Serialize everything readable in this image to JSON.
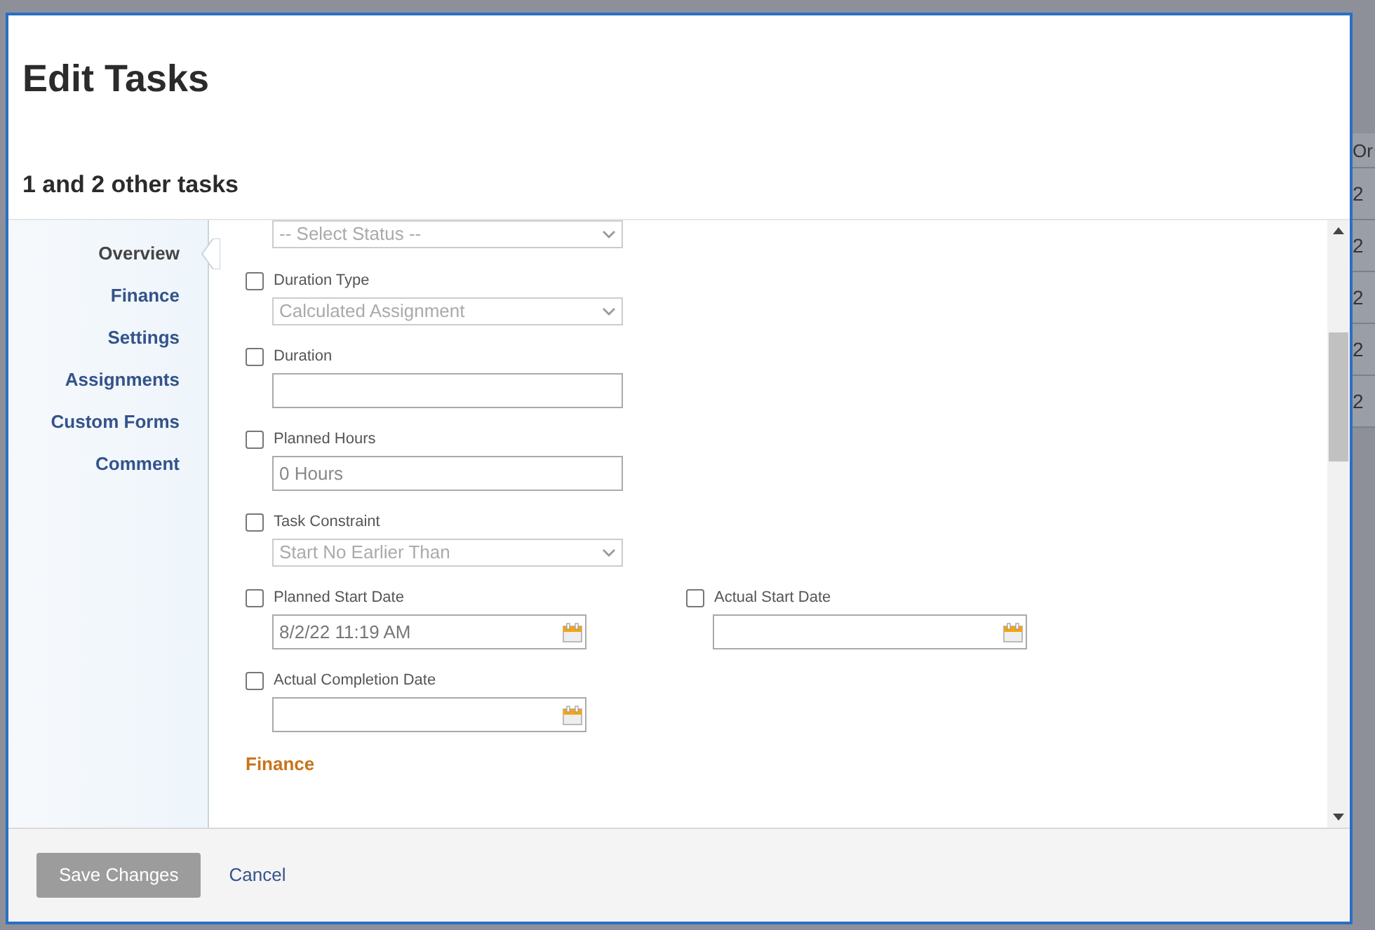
{
  "background_table": {
    "column_header": "Or",
    "cells": [
      "2",
      "2",
      "2",
      "2",
      "2"
    ]
  },
  "dialog": {
    "title": "Edit Tasks",
    "subtitle": "1 and 2 other tasks"
  },
  "sidebar": {
    "items": [
      {
        "label": "Overview",
        "selected": true
      },
      {
        "label": "Finance",
        "selected": false
      },
      {
        "label": "Settings",
        "selected": false
      },
      {
        "label": "Assignments",
        "selected": false
      },
      {
        "label": "Custom Forms",
        "selected": false
      },
      {
        "label": "Comment",
        "selected": false
      }
    ]
  },
  "form": {
    "rows": [
      [
        {
          "kind": "select",
          "value": "-- Select Status --"
        }
      ],
      [
        {
          "kind": "select",
          "label": "Duration Type",
          "checked": false,
          "value": "Calculated Assignment"
        }
      ],
      [
        {
          "kind": "input",
          "label": "Duration",
          "checked": false
        }
      ],
      [
        {
          "kind": "input",
          "label": "Planned Hours",
          "checked": false,
          "value": "0 Hours"
        }
      ],
      [
        {
          "kind": "select",
          "label": "Task Constraint",
          "checked": false,
          "value": "Start No Earlier Than"
        }
      ],
      [
        {
          "kind": "date",
          "label": "Planned Start Date",
          "checked": false,
          "value": "8/2/22 11:19 AM"
        },
        {
          "kind": "date",
          "label": "Actual Start Date",
          "checked": false
        }
      ],
      [
        {
          "kind": "date",
          "label": "Actual Completion Date",
          "checked": false
        }
      ]
    ],
    "next_section": "Finance"
  },
  "footer": {
    "buttons": [
      {
        "kind": "primary",
        "label": "Save Changes",
        "disabled": true
      },
      {
        "kind": "link",
        "label": "Cancel",
        "disabled": false
      }
    ]
  }
}
